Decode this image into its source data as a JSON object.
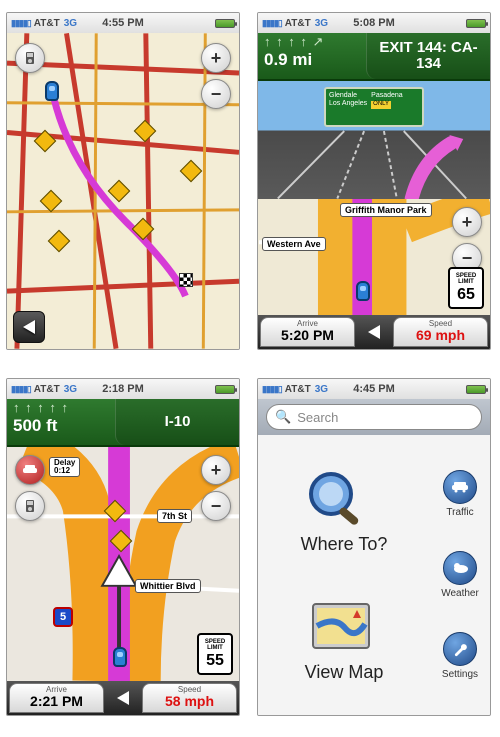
{
  "screens": {
    "s1": {
      "carrier": "AT&T",
      "net": "3G",
      "time": "4:55 PM",
      "zoom_in": "+",
      "zoom_out": "−"
    },
    "s2": {
      "carrier": "AT&T",
      "net": "3G",
      "time": "5:08 PM",
      "turn_arrows": "↑ ↑ ↑ ↑ ↗",
      "distance": "0.9 mi",
      "exit_label": "EXIT 144: CA-134",
      "sign_line1": "Glendale",
      "sign_line2": "Los Angeles",
      "sign_line3": "Pasadena",
      "sign_only": "ONLY",
      "park_label": "Griffith Manor Park",
      "street_label": "Western Ave",
      "speed_limit_top1": "SPEED",
      "speed_limit_top2": "LIMIT",
      "speed_limit_val": "65",
      "arrive_lbl": "Arrive",
      "arrive_val": "5:20 PM",
      "speed_lbl": "Speed",
      "speed_val": "69 mph",
      "zoom_in": "+",
      "zoom_out": "−"
    },
    "s3": {
      "carrier": "AT&T",
      "net": "3G",
      "time": "2:18 PM",
      "turn_arrows": "↑ ↑ ↑ ↑ ↑",
      "distance": "500 ft",
      "road_name": "I-10",
      "delay_lbl": "Delay",
      "delay_val": "0:12",
      "street1": "7th St",
      "street2": "Whittier Blvd",
      "shield": "5",
      "speed_limit_top1": "SPEED",
      "speed_limit_top2": "LIMIT",
      "speed_limit_val": "55",
      "arrive_lbl": "Arrive",
      "arrive_val": "2:21 PM",
      "speed_lbl": "Speed",
      "speed_val": "58 mph",
      "zoom_in": "+",
      "zoom_out": "−"
    },
    "s4": {
      "carrier": "AT&T",
      "net": "3G",
      "time": "4:45 PM",
      "search_placeholder": "Search",
      "where_to": "Where To?",
      "view_map": "View Map",
      "side": {
        "traffic": "Traffic",
        "weather": "Weather",
        "settings": "Settings"
      }
    }
  }
}
